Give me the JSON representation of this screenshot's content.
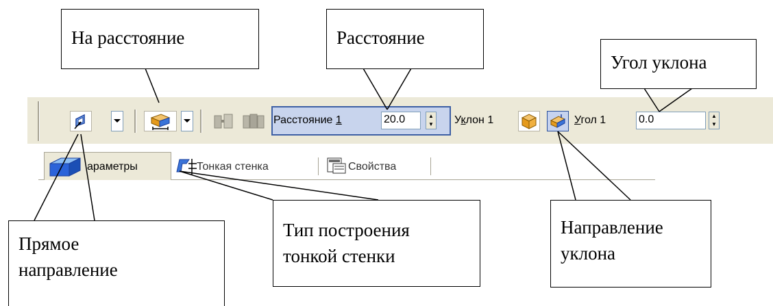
{
  "callouts": {
    "na_rasstoyanie": "На расстояние",
    "rasstoyanie": "Расстояние",
    "ugol_uklona": "Угол уклона",
    "pryamoe_line1": "Прямое",
    "pryamoe_line2": "направление",
    "tip_line1": "Тип построения",
    "tip_line2": "тонкой стенки",
    "napravlenie_line1": "Направление",
    "napravlenie_line2": "уклона"
  },
  "toolbar": {
    "distance_label": "Расстояние",
    "distance_hotkey": "1",
    "distance_value": "20.0",
    "slope_label_pre": "У",
    "slope_label_hot": "к",
    "slope_label_post": "лон 1",
    "angle_label_hot": "У",
    "angle_label_post": "гол 1",
    "angle_value": "0.0",
    "icons": [
      "direction-icon",
      "distance-mode-icon",
      "reverse-direction-icon",
      "two-directions-icon",
      "slope-outward-icon",
      "slope-inward-icon"
    ]
  },
  "tabs": [
    {
      "label": "араметры"
    },
    {
      "label": "Тонкая стенка"
    },
    {
      "label": "Свойства"
    }
  ],
  "colors": {
    "toolbar_bg": "#ece9d8",
    "highlight_bg": "#c8d4ed",
    "highlight_border": "#3d5fa4",
    "icon_blue": "#2b63d9",
    "icon_orange": "#e59a1c"
  }
}
